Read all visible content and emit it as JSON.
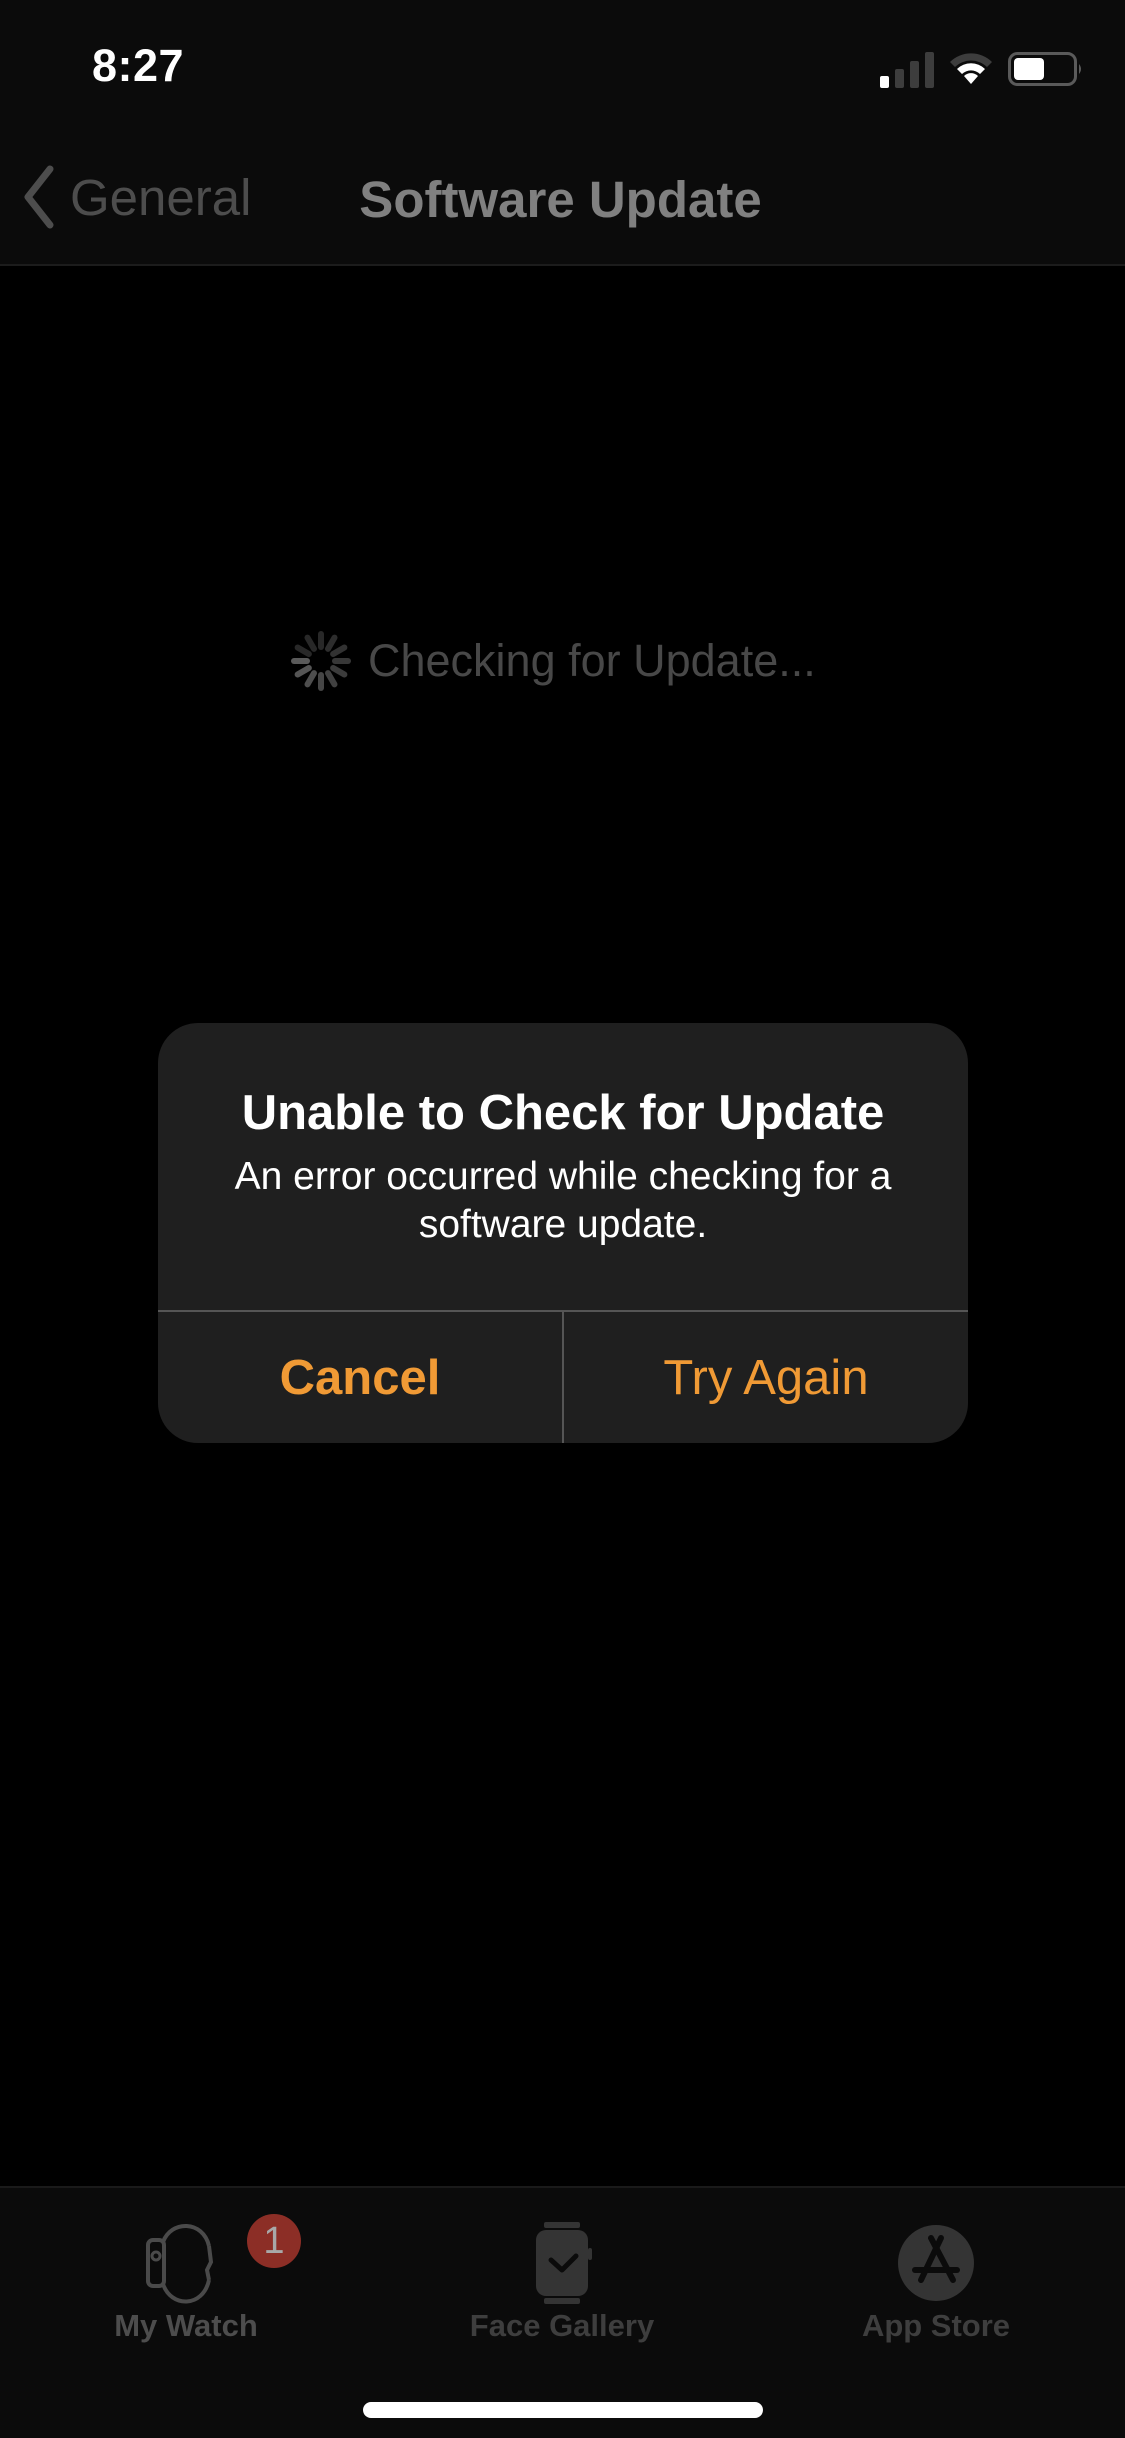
{
  "status_bar": {
    "time": "8:27",
    "signal_bars_active": 1,
    "signal_bars_total": 4,
    "wifi_arcs_active": 2,
    "wifi_arcs_total": 3,
    "battery_level_percent": 50
  },
  "nav": {
    "back_label": "General",
    "back_icon": "chevron-left-icon",
    "title": "Software Update"
  },
  "main": {
    "status_icon": "activity-spinner-icon",
    "status_text": "Checking for Update..."
  },
  "alert": {
    "title": "Unable to Check for Update",
    "message": "An error occurred while checking for a software update.",
    "cancel_label": "Cancel",
    "retry_label": "Try Again",
    "accent_color": "#F09A35"
  },
  "tab_bar": {
    "tabs": [
      {
        "label": "My Watch",
        "icon": "watch-side-icon",
        "badge": "1",
        "selected": false
      },
      {
        "label": "Face Gallery",
        "icon": "watch-face-icon",
        "selected": false
      },
      {
        "label": "App Store",
        "icon": "app-store-icon",
        "selected": false
      }
    ]
  }
}
